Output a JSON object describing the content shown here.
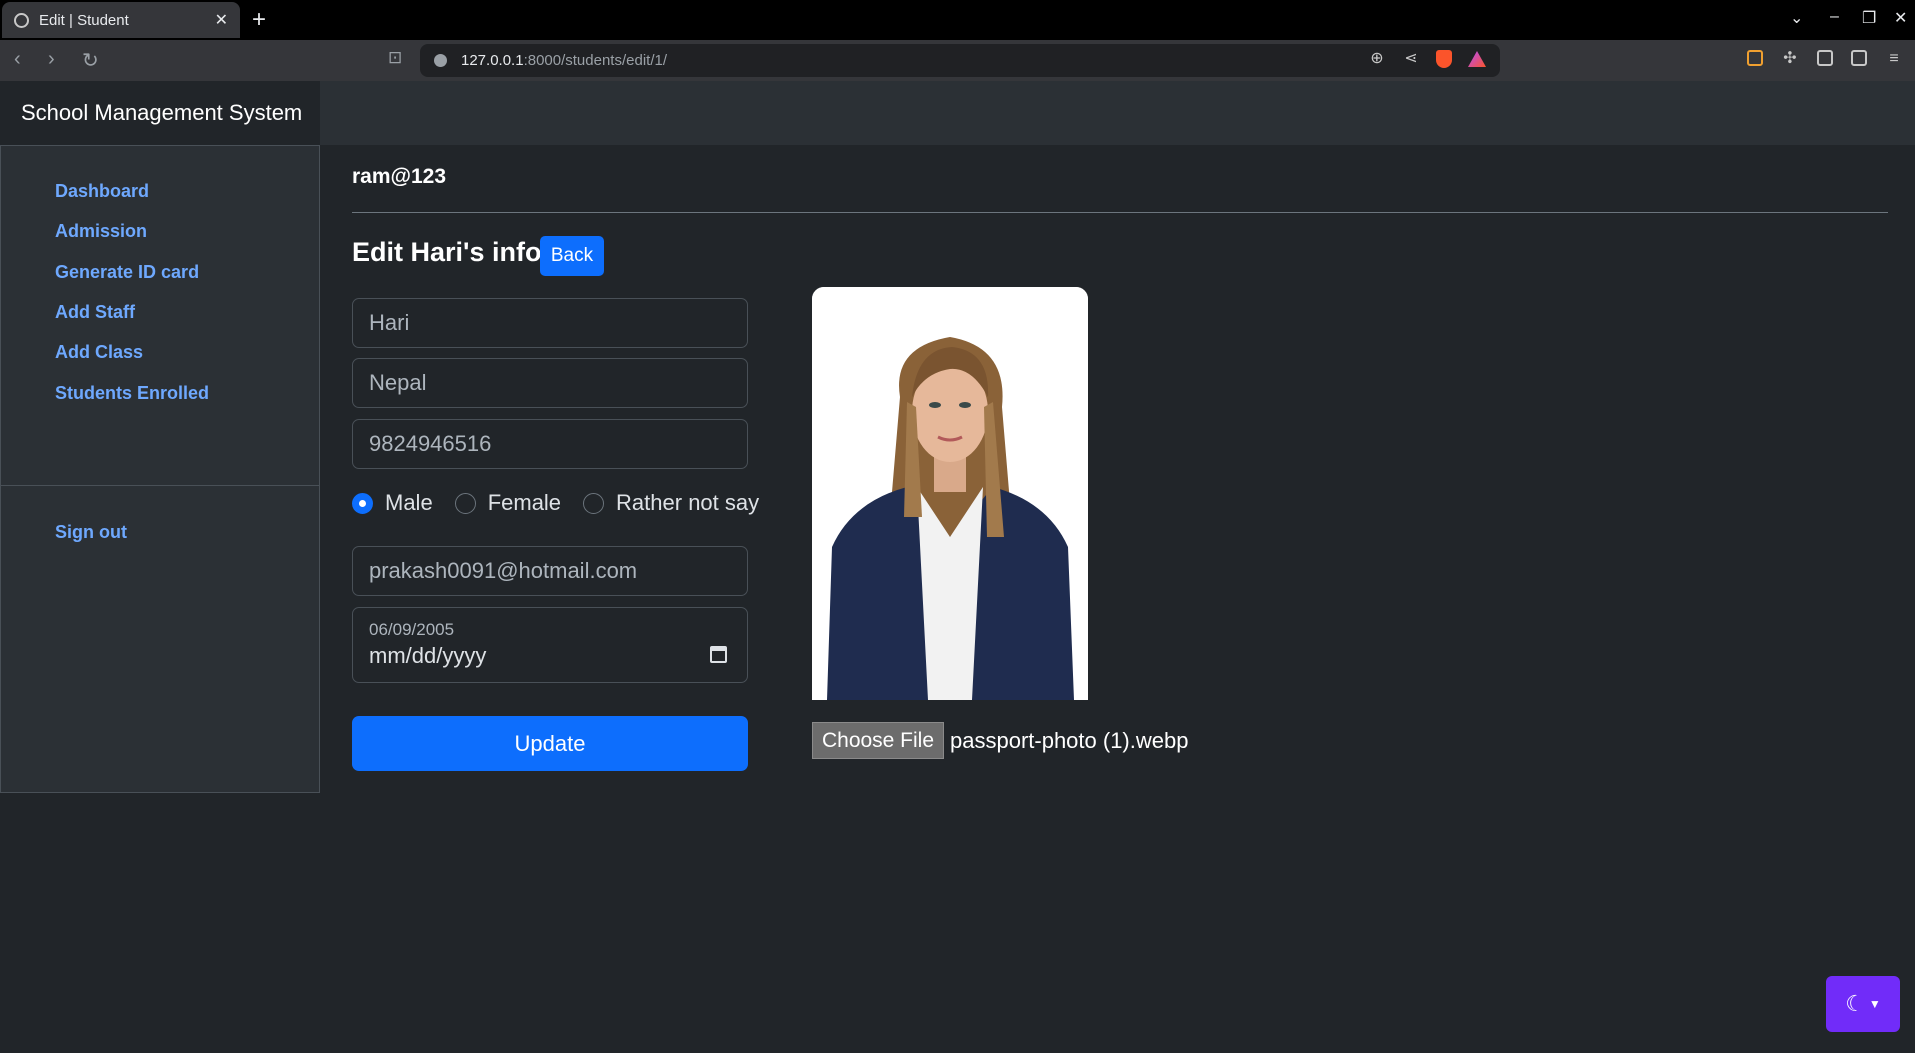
{
  "browser": {
    "tab_title": "Edit | Student",
    "url_host": "127.0.0.1",
    "url_path": ":8000/students/edit/1/"
  },
  "app": {
    "brand": "School Management System",
    "current_user": "ram@123"
  },
  "sidebar": {
    "items": [
      {
        "label": "Dashboard"
      },
      {
        "label": "Admission"
      },
      {
        "label": "Generate ID card"
      },
      {
        "label": "Add Staff"
      },
      {
        "label": "Add Class"
      },
      {
        "label": "Students Enrolled"
      }
    ],
    "sign_out": "Sign out"
  },
  "form": {
    "heading": "Edit Hari's info",
    "back_label": "Back",
    "name_value": "Hari",
    "address_value": "Nepal",
    "phone_value": "9824946516",
    "gender_options": [
      {
        "label": "Male",
        "checked": true
      },
      {
        "label": "Female",
        "checked": false
      },
      {
        "label": "Rather not say",
        "checked": false
      }
    ],
    "email_value": "prakash0091@hotmail.com",
    "dob_label": "06/09/2005",
    "dob_value": "mm/dd/yyyy",
    "update_label": "Update",
    "file_button_label": "Choose File",
    "file_name": "passport-photo (1).webp"
  },
  "colors": {
    "accent": "#0d6efd",
    "theme_toggle": "#712cf9",
    "link": "#6ea8fe"
  }
}
